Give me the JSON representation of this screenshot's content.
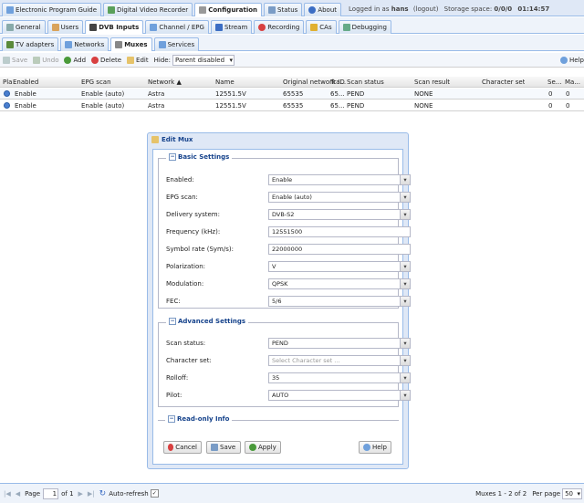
{
  "top_tabs": [
    {
      "label": "Electronic Program Guide",
      "icon": "epg-icon"
    },
    {
      "label": "Digital Video Recorder",
      "icon": "dvr-icon"
    },
    {
      "label": "Configuration",
      "icon": "wrench-icon",
      "active": true
    },
    {
      "label": "Status",
      "icon": "status-icon"
    },
    {
      "label": "About",
      "icon": "info-icon"
    }
  ],
  "login": {
    "prefix": "Logged in as",
    "user": "hans",
    "logout": "(logout)",
    "storage_label": "Storage space:",
    "storage_value": "0/0/0",
    "clock": "01:14:57"
  },
  "config_tabs": [
    {
      "label": "General",
      "icon": "general-icon"
    },
    {
      "label": "Users",
      "icon": "users-icon"
    },
    {
      "label": "DVB Inputs",
      "icon": "dvb-icon",
      "active": true
    },
    {
      "label": "Channel / EPG",
      "icon": "channel-icon"
    },
    {
      "label": "Stream",
      "icon": "stream-icon"
    },
    {
      "label": "Recording",
      "icon": "recording-icon"
    },
    {
      "label": "CAs",
      "icon": "key-icon"
    },
    {
      "label": "Debugging",
      "icon": "debug-icon"
    }
  ],
  "dvb_tabs": [
    {
      "label": "TV adapters",
      "icon": "tv-icon"
    },
    {
      "label": "Networks",
      "icon": "network-icon"
    },
    {
      "label": "Muxes",
      "icon": "mux-icon",
      "active": true
    },
    {
      "label": "Services",
      "icon": "services-icon"
    }
  ],
  "toolbar": {
    "save": "Save",
    "undo": "Undo",
    "add": "Add",
    "delete": "Delete",
    "edit": "Edit",
    "hide_label": "Hide:",
    "hide_value": "Parent disabled",
    "help": "Help"
  },
  "grid": {
    "columns": [
      "Play",
      "Enabled",
      "EPG scan",
      "Network ▲",
      "Name",
      "Original network ID",
      "Tra...",
      "Scan status",
      "Scan result",
      "Character set",
      "Se...",
      "Ma..."
    ],
    "rows": [
      [
        "Enable",
        "Enable (auto)",
        "Astra",
        "12551.5V",
        "65535",
        "65...",
        "PEND",
        "NONE",
        "",
        "0",
        "0"
      ],
      [
        "Enable",
        "Enable (auto)",
        "Astra",
        "12551.5V",
        "65535",
        "65...",
        "PEND",
        "NONE",
        "",
        "0",
        "0"
      ]
    ]
  },
  "dialog": {
    "title": "Edit Mux",
    "basic": {
      "legend": "Basic Settings",
      "fields": [
        {
          "label": "Enabled:",
          "value": "Enable",
          "combo": true
        },
        {
          "label": "EPG scan:",
          "value": "Enable (auto)",
          "combo": true
        },
        {
          "label": "Delivery system:",
          "value": "DVB-S2",
          "combo": true
        },
        {
          "label": "Frequency (kHz):",
          "value": "12551500",
          "combo": false
        },
        {
          "label": "Symbol rate (Sym/s):",
          "value": "22000000",
          "combo": false
        },
        {
          "label": "Polarization:",
          "value": "V",
          "combo": true
        },
        {
          "label": "Modulation:",
          "value": "QPSK",
          "combo": true
        },
        {
          "label": "FEC:",
          "value": "5/6",
          "combo": true
        }
      ]
    },
    "advanced": {
      "legend": "Advanced Settings",
      "fields": [
        {
          "label": "Scan status:",
          "value": "PEND",
          "combo": true
        },
        {
          "label": "Character set:",
          "value": "",
          "placeholder": "Select Character set ...",
          "combo": true
        },
        {
          "label": "Rolloff:",
          "value": "35",
          "combo": true
        },
        {
          "label": "Pilot:",
          "value": "AUTO",
          "combo": true
        }
      ]
    },
    "readonly": {
      "legend": "Read-only Info"
    },
    "buttons": {
      "cancel": "Cancel",
      "save": "Save",
      "apply": "Apply",
      "help": "Help"
    }
  },
  "pager": {
    "page_label": "Page",
    "page_value": "1",
    "of": "of 1",
    "auto_refresh": "Auto-refresh",
    "summary": "Muxes 1 - 2 of 2",
    "per_page_label": "Per page",
    "per_page_value": "50"
  },
  "colors": {
    "accent": "#15428b",
    "border": "#99bbe8",
    "panel": "#dfe8f6"
  }
}
